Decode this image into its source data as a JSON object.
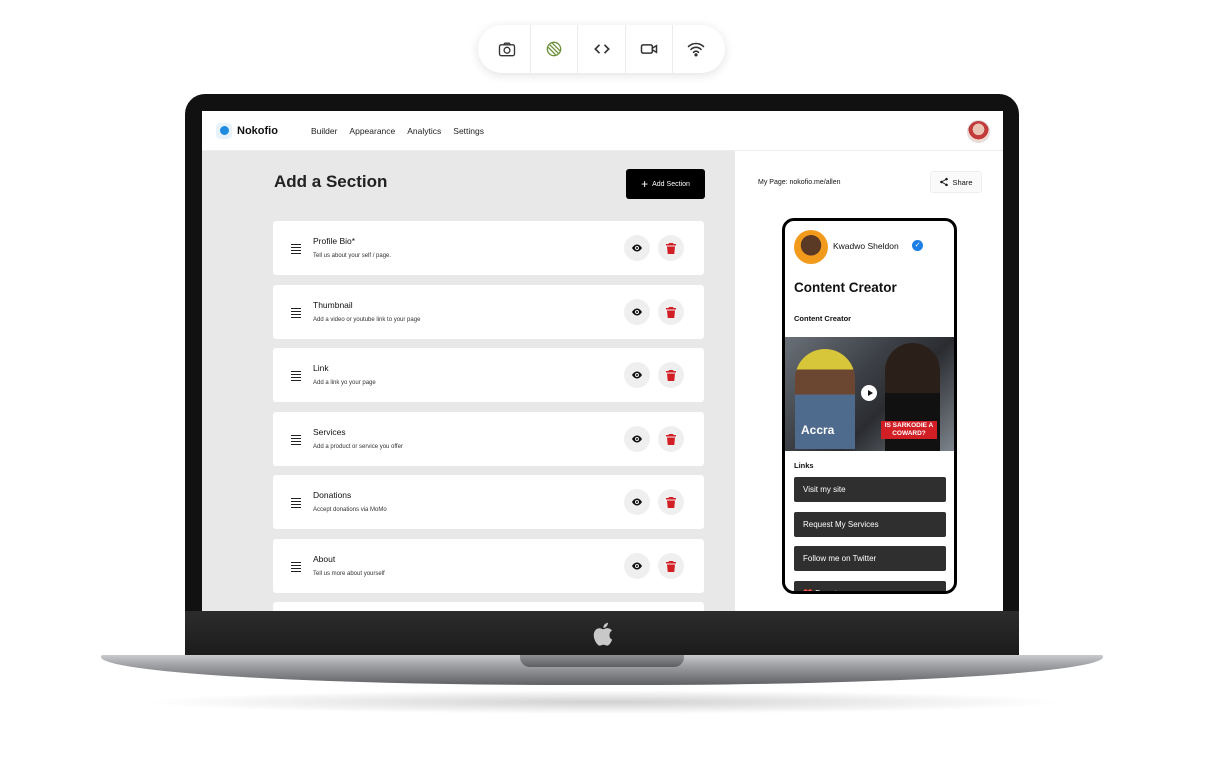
{
  "toolbar": {
    "icons": [
      "camera-icon",
      "rotate-icon",
      "code-icon",
      "video-icon",
      "wifi-icon"
    ]
  },
  "app": {
    "brand": "Nokofio",
    "nav": [
      "Builder",
      "Appearance",
      "Analytics",
      "Settings"
    ]
  },
  "builder": {
    "title": "Add a Section",
    "add_button": "Add Section",
    "sections": [
      {
        "title": "Profile Bio*",
        "subtitle": "Tell us about your self / page."
      },
      {
        "title": "Thumbnail",
        "subtitle": "Add a video or youtube link to your page"
      },
      {
        "title": "Link",
        "subtitle": "Add a link yo your page"
      },
      {
        "title": "Services",
        "subtitle": "Add a product or service you offer"
      },
      {
        "title": "Donations",
        "subtitle": "Accept donations via MoMo"
      },
      {
        "title": "About",
        "subtitle": "Tell us more about yourself"
      }
    ]
  },
  "preview": {
    "my_page": "My Page: nokofio.me/allen",
    "share_label": "Share",
    "profile_name": "Kwadwo Sheldon",
    "headline": "Content Creator",
    "subheadline": "Content Creator",
    "video": {
      "overlay_text": "Accra",
      "tag": "IS SARKODIE A COWARD?"
    },
    "links_label": "Links",
    "links": [
      "Visit my site",
      "Request My Services",
      "Follow me on Twitter",
      "❤️ Donate"
    ]
  },
  "colors": {
    "accent_red": "#d21e25",
    "brand_blue": "#1f8be0",
    "dark_button": "#2f2f2f"
  }
}
